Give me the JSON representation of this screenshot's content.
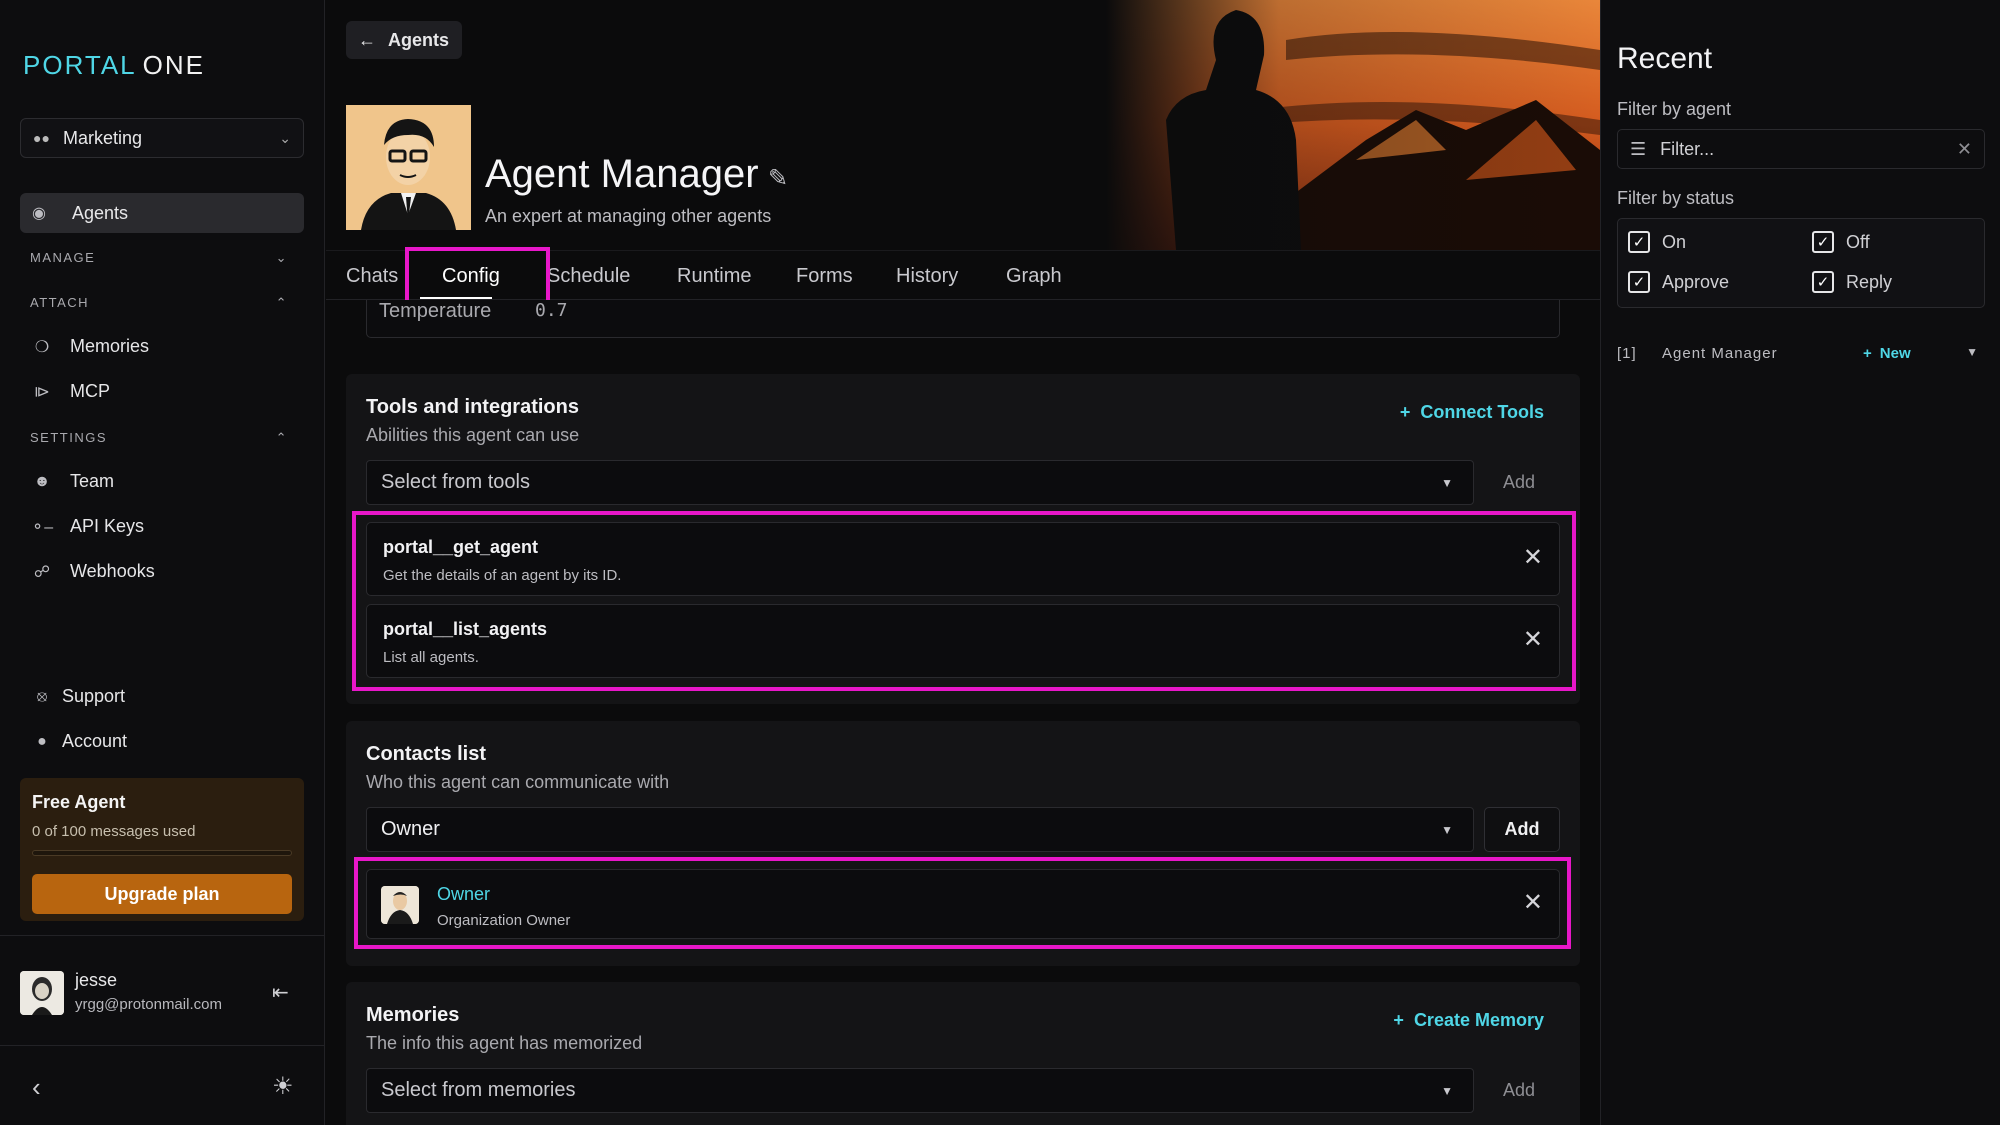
{
  "brand": {
    "part1": "PORTAL",
    "part2": "ONE"
  },
  "workspace": {
    "name": "Marketing"
  },
  "sidebar": {
    "active_item": "Agents",
    "sections": {
      "manage": "MANAGE",
      "attach": "ATTACH",
      "settings": "SETTINGS"
    },
    "attach_items": [
      "Memories",
      "MCP"
    ],
    "settings_items": [
      "Team",
      "API Keys",
      "Webhooks"
    ],
    "footer_items": [
      "Support",
      "Account"
    ]
  },
  "plan": {
    "title": "Free Agent",
    "usage": "0 of 100 messages used",
    "usage_fraction": 0,
    "upgrade_label": "Upgrade plan"
  },
  "user": {
    "name": "jesse",
    "email": "yrgg@protonmail.com"
  },
  "header": {
    "back_label": "Agents",
    "agent_name": "Agent Manager",
    "agent_description": "An expert at managing other agents"
  },
  "tabs": [
    "Chats",
    "Config",
    "Schedule",
    "Runtime",
    "Forms",
    "History",
    "Graph"
  ],
  "active_tab": "Config",
  "temperature": {
    "label": "Temperature",
    "value": "0.7"
  },
  "tools": {
    "title": "Tools and integrations",
    "description": "Abilities this agent can use",
    "connect_label": "Connect Tools",
    "select_placeholder": "Select from tools",
    "add_label": "Add",
    "items": [
      {
        "name": "portal__get_agent",
        "description": "Get the details of an agent by its ID."
      },
      {
        "name": "portal__list_agents",
        "description": "List all agents."
      }
    ]
  },
  "contacts": {
    "title": "Contacts list",
    "description": "Who this agent can communicate with",
    "selected": "Owner",
    "add_label": "Add",
    "items": [
      {
        "name": "Owner",
        "role": "Organization Owner"
      }
    ]
  },
  "memories": {
    "title": "Memories",
    "description": "The info this agent has memorized",
    "create_label": "Create Memory",
    "select_placeholder": "Select from memories",
    "add_label": "Add"
  },
  "recent": {
    "title": "Recent",
    "filter_agent_label": "Filter by agent",
    "filter_placeholder": "Filter...",
    "filter_status_label": "Filter by status",
    "statuses": [
      "On",
      "Off",
      "Approve",
      "Reply"
    ],
    "row": {
      "index": "[1]",
      "name": "Agent Manager",
      "new_label": "New"
    }
  },
  "colors": {
    "accent": "#4fd6e6",
    "highlight": "#e817c9",
    "upgrade": "#b8650f"
  }
}
